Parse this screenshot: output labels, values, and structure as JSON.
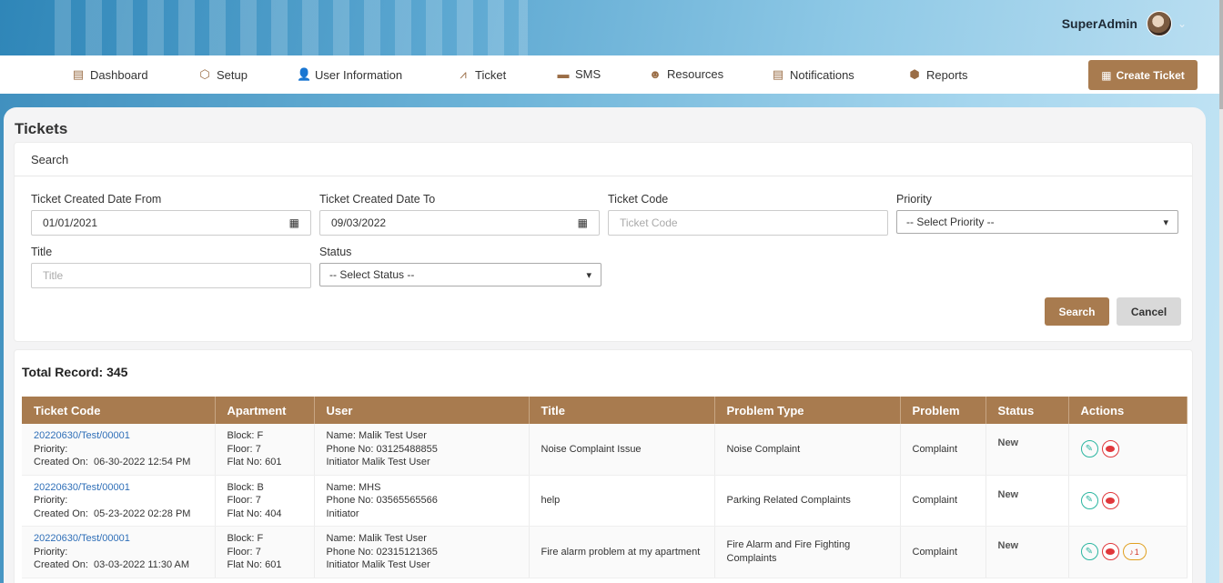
{
  "header": {
    "user_name": "SuperAdmin",
    "chevron": "⌄"
  },
  "nav": {
    "items": [
      {
        "label": "Dashboard",
        "icon": "dashboard-icon",
        "glyph": "▤"
      },
      {
        "label": "Setup",
        "icon": "cube-icon",
        "glyph": "⬡"
      },
      {
        "label": "User Information",
        "icon": "user-plus-icon",
        "glyph": "👤"
      },
      {
        "label": "Ticket",
        "icon": "chart-line-icon",
        "glyph": "⩘"
      },
      {
        "label": "SMS",
        "icon": "message-icon",
        "glyph": "▬"
      },
      {
        "label": "Resources",
        "icon": "smile-icon",
        "glyph": "☻"
      },
      {
        "label": "Notifications",
        "icon": "document-icon",
        "glyph": "▤"
      },
      {
        "label": "Reports",
        "icon": "cubes-icon",
        "glyph": "⬢"
      }
    ],
    "create_ticket": "Create Ticket",
    "create_ticket_glyph": "▦"
  },
  "page": {
    "title": "Tickets"
  },
  "search": {
    "heading": "Search",
    "date_from": {
      "label": "Ticket Created Date From",
      "value": "01/01/2021"
    },
    "date_to": {
      "label": "Ticket Created Date To",
      "value": "09/03/2022"
    },
    "ticket_code": {
      "label": "Ticket Code",
      "placeholder": "Ticket Code"
    },
    "priority": {
      "label": "Priority",
      "selected": "-- Select Priority --"
    },
    "title": {
      "label": "Title",
      "placeholder": "Title"
    },
    "status": {
      "label": "Status",
      "selected": "-- Select Status --"
    },
    "search_button": "Search",
    "cancel_button": "Cancel"
  },
  "results": {
    "total_label": "Total Record: 345",
    "columns": [
      "Ticket Code",
      "Apartment",
      "User",
      "Title",
      "Problem Type",
      "Problem",
      "Status",
      "Actions"
    ],
    "rows": [
      {
        "code": "20220630/Test/00001",
        "priority_label": "Priority:",
        "created_label": "Created On:",
        "created_on": "06-30-2022 12:54 PM",
        "block": "F",
        "floor": "7",
        "flat": "601",
        "user_name": "Malik Test User",
        "phone": "03125488855",
        "initiator": "Malik Test User",
        "title": "Noise Complaint Issue",
        "problem_type": "Noise Complaint",
        "problem": "Complaint",
        "status": "New",
        "bell_count": ""
      },
      {
        "code": "20220630/Test/00001",
        "priority_label": "Priority:",
        "created_label": "Created On:",
        "created_on": "05-23-2022 02:28 PM",
        "block": "B",
        "floor": "7",
        "flat": "404",
        "user_name": "MHS",
        "phone": "03565565566",
        "initiator": "",
        "title": "help",
        "problem_type": "Parking Related Complaints",
        "problem": "Complaint",
        "status": "New",
        "bell_count": ""
      },
      {
        "code": "20220630/Test/00001",
        "priority_label": "Priority:",
        "created_label": "Created On:",
        "created_on": "03-03-2022 11:30 AM",
        "block": "F",
        "floor": "7",
        "flat": "601",
        "user_name": "Malik Test User",
        "phone": "02315121365",
        "initiator": "Malik Test User",
        "title": "Fire alarm problem at my apartment",
        "problem_type": "Fire Alarm and Fire Fighting Complaints",
        "problem": "Complaint",
        "status": "New",
        "bell_count": "1"
      }
    ],
    "labels": {
      "block": "Block:",
      "floor": "Floor:",
      "flat": "Flat No:",
      "name": "Name:",
      "phone": "Phone No:",
      "initiator": "Initiator"
    }
  },
  "colors": {
    "accent": "#a87b4f",
    "link": "#2f6fb8",
    "edit": "#2ab5a0",
    "comment": "#e0373b",
    "bell": "#e0a020"
  }
}
